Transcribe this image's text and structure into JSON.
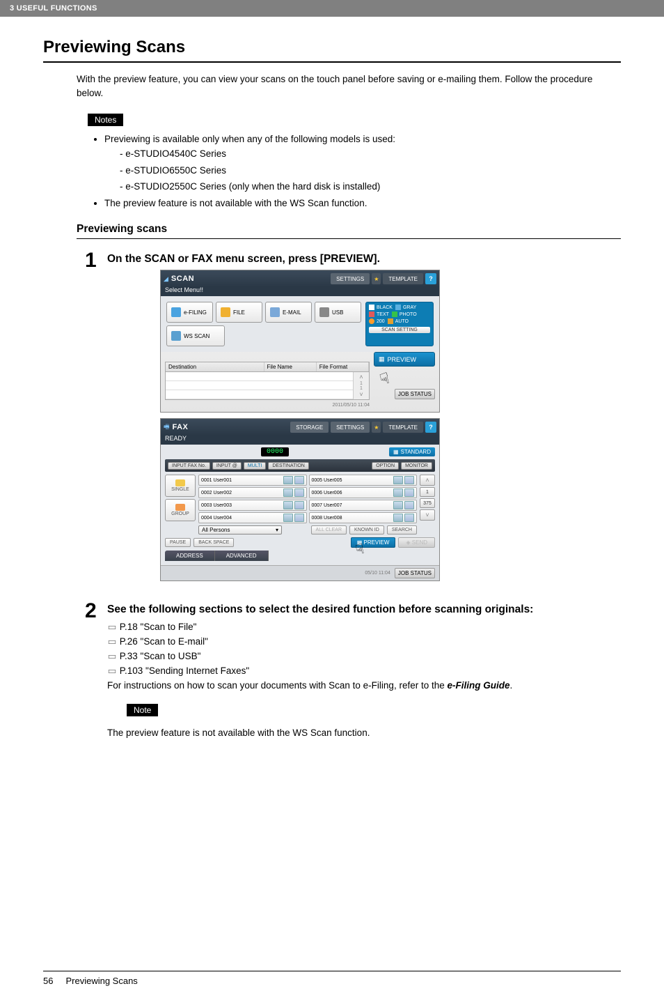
{
  "header": {
    "breadcrumb": "3 USEFUL FUNCTIONS"
  },
  "title": "Previewing Scans",
  "intro": "With the preview feature, you can view your scans on the touch panel before saving or e-mailing them. Follow the procedure below.",
  "notes_label": "Notes",
  "notes": {
    "bullet1": "Previewing is available only when any of the following models is used:",
    "models": [
      "e-STUDIO4540C Series",
      "e-STUDIO6550C Series",
      "e-STUDIO2550C Series (only when the hard disk is installed)"
    ],
    "bullet2": "The preview feature is not available with the WS Scan function."
  },
  "subsection": "Previewing scans",
  "step1": {
    "num": "1",
    "heading": "On the SCAN or FAX menu screen, press [PREVIEW].",
    "scan_panel": {
      "title": "SCAN",
      "subtitle": "Select Menu!!",
      "settings": "SETTINGS",
      "template": "TEMPLATE",
      "buttons": {
        "efiling": "e-FILING",
        "file": "FILE",
        "email": "E-MAIL",
        "usb": "USB",
        "wsscan": "WS SCAN"
      },
      "side": {
        "black": "BLACK",
        "gray": "GRAY",
        "text": "TEXT",
        "photo": "PHOTO",
        "resolution": "200",
        "auto": "AUTO",
        "scansetting": "SCAN SETTING"
      },
      "grid": {
        "destination": "Destination",
        "filename": "File Name",
        "fileformat": "File Format"
      },
      "preview": "PREVIEW",
      "date": "2011/05/10\n11:04",
      "jobstatus": "JOB STATUS"
    },
    "fax_panel": {
      "title": "FAX",
      "ready": "READY",
      "storage": "STORAGE",
      "settings": "SETTINGS",
      "template": "TEMPLATE",
      "toolbar": {
        "inputfax": "INPUT FAX No.",
        "inputat": "INPUT @",
        "multi": "MULTI",
        "destination": "DESTINATION",
        "option": "OPTION",
        "monitor": "MONITOR"
      },
      "counter": "0000",
      "standard": "STANDARD",
      "left": {
        "single": "SINGLE",
        "group": "GROUP"
      },
      "users": [
        {
          "id": "0001",
          "name": "User001"
        },
        {
          "id": "0002",
          "name": "User002"
        },
        {
          "id": "0003",
          "name": "User003"
        },
        {
          "id": "0004",
          "name": "User004"
        },
        {
          "id": "0005",
          "name": "User005"
        },
        {
          "id": "0006",
          "name": "User006"
        },
        {
          "id": "0007",
          "name": "User007"
        },
        {
          "id": "0008",
          "name": "User008"
        }
      ],
      "page_indicator": "1",
      "page_total": "375",
      "allpersons": "All Persons",
      "allclear": "ALL CLEAR",
      "knownid": "KNOWN ID",
      "search": "SEARCH",
      "pause": "PAUSE",
      "backspace": "BACK SPACE",
      "preview": "PREVIEW",
      "send": "SEND",
      "tabs": {
        "address": "ADDRESS",
        "advanced": "ADVANCED"
      },
      "date": "05/10\n11:04",
      "jobstatus": "JOB STATUS"
    }
  },
  "step2": {
    "num": "2",
    "heading": "See the following sections to select the desired function before scanning originals:",
    "refs": [
      "P.18 \"Scan to File\"",
      "P.26 \"Scan to E-mail\"",
      "P.33 \"Scan to USB\"",
      "P.103 \"Sending Internet Faxes\""
    ],
    "tail_a": "For instructions on how to scan your documents with Scan to e-Filing, refer to the ",
    "tail_b": "e-Filing Guide",
    "tail_c": "."
  },
  "note_label": "Note",
  "note_text": "The preview feature is not available with the WS Scan function.",
  "footer": {
    "pagenum": "56",
    "title": "Previewing Scans"
  }
}
